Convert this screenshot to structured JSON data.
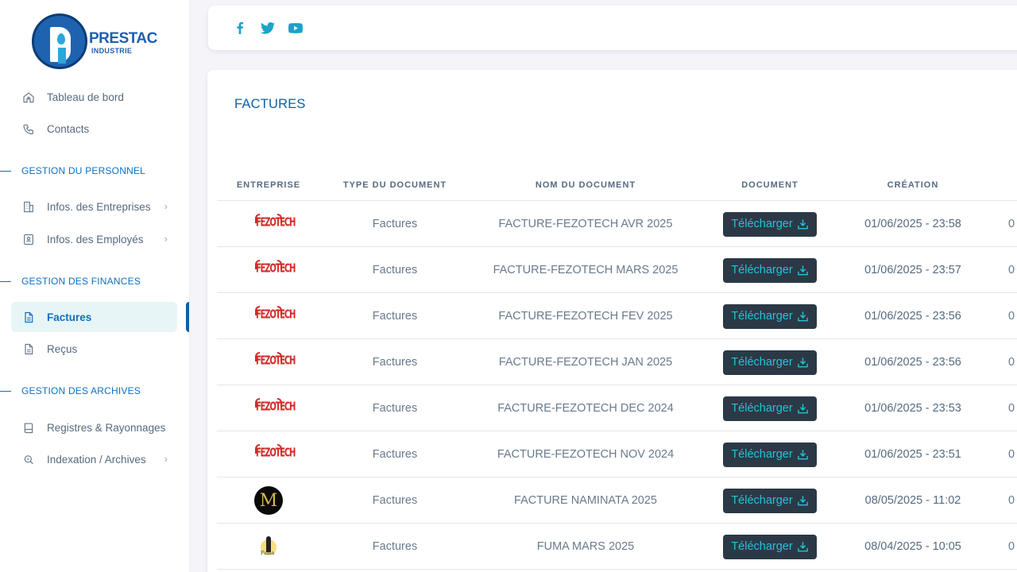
{
  "brand": {
    "name": "PRESTAC",
    "tagline": "INDUSTRIE"
  },
  "sidebar": {
    "top_items": [
      {
        "label": "Tableau de bord",
        "icon": "home-icon"
      },
      {
        "label": "Contacts",
        "icon": "phone-icon"
      }
    ],
    "sections": [
      {
        "title": "GESTION DU PERSONNEL",
        "items": [
          {
            "label": "Infos. des Entreprises",
            "icon": "building-icon",
            "has_submenu": true
          },
          {
            "label": "Infos. des Employés",
            "icon": "id-card-icon",
            "has_submenu": true
          }
        ]
      },
      {
        "title": "GESTION DES FINANCES",
        "items": [
          {
            "label": "Factures",
            "icon": "file-text-icon",
            "active": true
          },
          {
            "label": "Reçus",
            "icon": "file-icon"
          }
        ]
      },
      {
        "title": "GESTION DES ARCHIVES",
        "items": [
          {
            "label": "Registres & Rayonnages",
            "icon": "book-icon"
          },
          {
            "label": "Indexation / Archives",
            "icon": "search-icon",
            "has_submenu": true
          }
        ]
      }
    ]
  },
  "topbar": {
    "social": [
      "facebook-icon",
      "twitter-icon",
      "youtube-icon"
    ]
  },
  "page": {
    "title": "FACTURES"
  },
  "table": {
    "headers": [
      "ENTREPRISE",
      "TYPE DU DOCUMENT",
      "NOM DU DOCUMENT",
      "DOCUMENT",
      "CRÉATION"
    ],
    "download_label": "Télécharger",
    "rows": [
      {
        "company_logo": "fezotech-logo",
        "logo_text": "FEZOTECH",
        "type": "Factures",
        "name": "FACTURE-FEZOTECH AVR 2025",
        "created": "01/06/2025 - 23:58",
        "extra": "0"
      },
      {
        "company_logo": "fezotech-logo",
        "logo_text": "FEZOTECH",
        "type": "Factures",
        "name": "FACTURE-FEZOTECH MARS 2025",
        "created": "01/06/2025 - 23:57",
        "extra": "0"
      },
      {
        "company_logo": "fezotech-logo",
        "logo_text": "FEZOTECH",
        "type": "Factures",
        "name": "FACTURE-FEZOTECH FEV 2025",
        "created": "01/06/2025 - 23:56",
        "extra": "0"
      },
      {
        "company_logo": "fezotech-logo",
        "logo_text": "FEZOTECH",
        "type": "Factures",
        "name": "FACTURE-FEZOTECH JAN 2025",
        "created": "01/06/2025 - 23:56",
        "extra": "0"
      },
      {
        "company_logo": "fezotech-logo",
        "logo_text": "FEZOTECH",
        "type": "Factures",
        "name": "FACTURE-FEZOTECH DEC 2024",
        "created": "01/06/2025 - 23:53",
        "extra": "0"
      },
      {
        "company_logo": "fezotech-logo",
        "logo_text": "FEZOTECH",
        "type": "Factures",
        "name": "FACTURE-FEZOTECH NOV 2024",
        "created": "01/06/2025 - 23:51",
        "extra": "0"
      },
      {
        "company_logo": "naminata-logo",
        "logo_text": "M",
        "type": "Factures",
        "name": "FACTURE NAMINATA 2025",
        "created": "08/05/2025 - 11:02",
        "extra": "0"
      },
      {
        "company_logo": "fuma-logo",
        "logo_text": "Fuma",
        "type": "Factures",
        "name": "FUMA MARS 2025",
        "created": "08/04/2025 - 10:05",
        "extra": "0"
      }
    ]
  },
  "colors": {
    "accent": "#0c6fc4",
    "button_bg": "#2b3946",
    "button_text": "#27c1d9",
    "social": "#1aa3c9"
  }
}
